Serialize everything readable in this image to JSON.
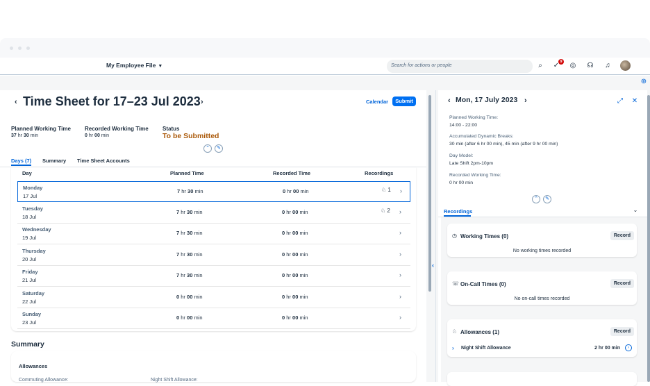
{
  "shell": {
    "app_title": "My Employee File",
    "search_placeholder": "Search for actions or people",
    "notification_count": "9"
  },
  "timesheet": {
    "title": "Time Sheet for 17–23 Jul 2023",
    "calendar_label": "Calendar",
    "submit_label": "Submit",
    "planned_label": "Planned Working Time",
    "planned_hr": "37",
    "planned_min": "30",
    "recorded_label": "Recorded Working Time",
    "recorded_hr": "0",
    "recorded_min": "00",
    "status_label": "Status",
    "status_value": "To be Submitted",
    "tabs": [
      "Days (7)",
      "Summary",
      "Time Sheet Accounts"
    ],
    "columns": [
      "Day",
      "Planned Time",
      "Recorded Time",
      "Recordings"
    ],
    "rows": [
      {
        "day": "Monday",
        "date": "17 Jul",
        "p_hr": "7",
        "p_min": "30",
        "r_hr": "0",
        "r_min": "00",
        "rec": "1"
      },
      {
        "day": "Tuesday",
        "date": "18 Jul",
        "p_hr": "7",
        "p_min": "30",
        "r_hr": "0",
        "r_min": "00",
        "rec": "2"
      },
      {
        "day": "Wednesday",
        "date": "19 Jul",
        "p_hr": "7",
        "p_min": "30",
        "r_hr": "0",
        "r_min": "00",
        "rec": ""
      },
      {
        "day": "Thursday",
        "date": "20 Jul",
        "p_hr": "7",
        "p_min": "30",
        "r_hr": "0",
        "r_min": "00",
        "rec": ""
      },
      {
        "day": "Friday",
        "date": "21 Jul",
        "p_hr": "7",
        "p_min": "30",
        "r_hr": "0",
        "r_min": "00",
        "rec": ""
      },
      {
        "day": "Saturday",
        "date": "22 Jul",
        "p_hr": "0",
        "p_min": "00",
        "r_hr": "0",
        "r_min": "00",
        "rec": ""
      },
      {
        "day": "Sunday",
        "date": "23 Jul",
        "p_hr": "0",
        "p_min": "00",
        "r_hr": "0",
        "r_min": "00",
        "rec": ""
      }
    ],
    "units": {
      "hr": "hr",
      "min": "min"
    },
    "summary_title": "Summary",
    "summary_allowances": "Allowances",
    "summary_item1": "Commuting Allowance:",
    "summary_item2": "Night Shift Allowance:"
  },
  "detail": {
    "title": "Mon, 17 July 2023",
    "planned_label": "Planned Working Time:",
    "planned_value": "14:00 - 22:00",
    "breaks_label": "Accumulated Dynamic Breaks:",
    "breaks_value": "30 min (after 6 hr 00 min), 45 min (after 9 hr 00 min)",
    "daymodel_label": "Day Model:",
    "daymodel_value": "Late Shift 2pm-10pm",
    "recorded_label": "Recorded Working Time:",
    "recorded_value": "0 hr 00 min",
    "tab_label": "Recordings",
    "cards": {
      "working_title": "Working Times (0)",
      "working_empty": "No working times recorded",
      "oncall_title": "On-Call Times (0)",
      "oncall_empty": "No on-call times recorded",
      "allow_title": "Allowances (1)",
      "allow_item": "Night Shift Allowance",
      "allow_value": "2 hr 00 min",
      "record_label": "Record"
    }
  }
}
